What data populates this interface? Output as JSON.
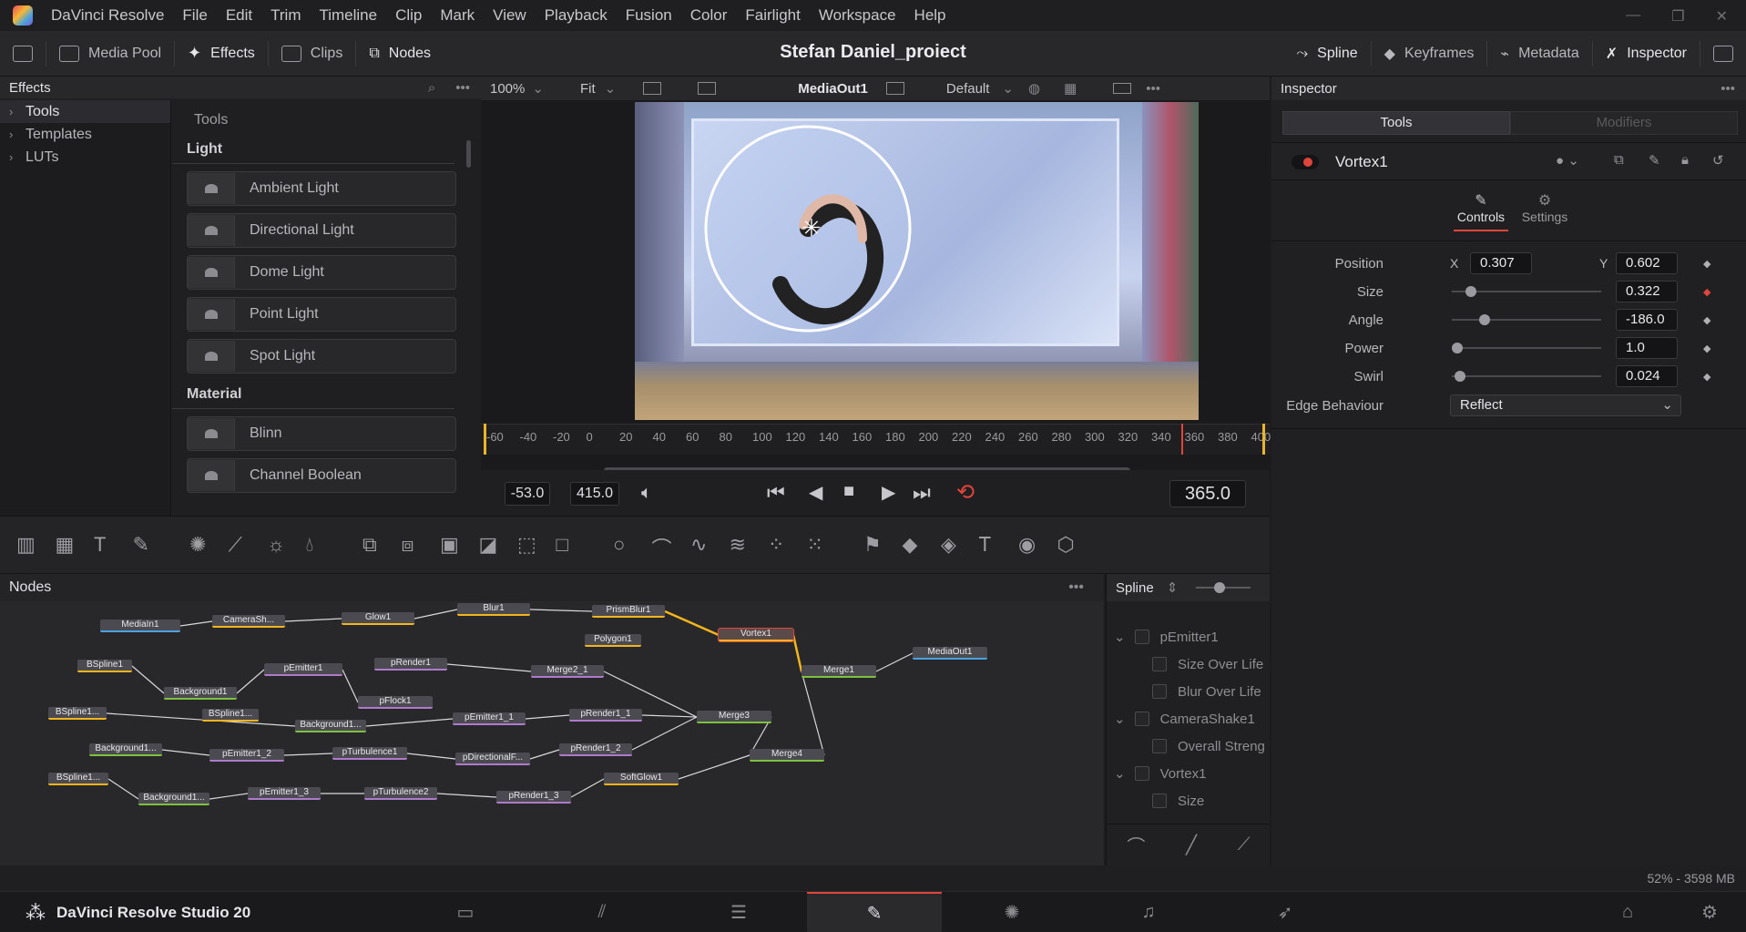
{
  "menubar": {
    "app": "DaVinci Resolve",
    "items": [
      "File",
      "Edit",
      "Trim",
      "Timeline",
      "Clip",
      "Mark",
      "View",
      "Playback",
      "Fusion",
      "Color",
      "Fairlight",
      "Workspace",
      "Help"
    ]
  },
  "toolbar": {
    "media_pool": "Media Pool",
    "effects": "Effects",
    "clips": "Clips",
    "nodes": "Nodes",
    "project_title": "Stefan Daniel_proiect",
    "spline": "Spline",
    "keyframes": "Keyframes",
    "metadata": "Metadata",
    "inspector": "Inspector"
  },
  "effects": {
    "title": "Effects",
    "tree": [
      "Tools",
      "Templates",
      "LUTs"
    ],
    "list_title": "Tools",
    "sections": [
      {
        "name": "Light",
        "items": [
          "Ambient Light",
          "Directional Light",
          "Dome Light",
          "Point Light",
          "Spot Light"
        ]
      },
      {
        "name": "Material",
        "items": [
          "Blinn",
          "Channel Boolean"
        ]
      }
    ]
  },
  "viewer": {
    "zoom": "100%",
    "fit": "Fit",
    "output": "MediaOut1",
    "lut": "Default",
    "ruler": [
      "-60",
      "-40",
      "-20",
      "0",
      "20",
      "40",
      "60",
      "80",
      "100",
      "120",
      "140",
      "160",
      "180",
      "200",
      "220",
      "240",
      "260",
      "280",
      "300",
      "320",
      "340",
      "360",
      "380",
      "400"
    ],
    "in": "-53.0",
    "out": "415.0",
    "current": "365.0"
  },
  "inspector": {
    "title": "Inspector",
    "tabs": [
      "Tools",
      "Modifiers"
    ],
    "tool_name": "Vortex1",
    "subtabs": [
      "Controls",
      "Settings"
    ],
    "position_label": "Position",
    "x_label": "X",
    "x": "0.307",
    "y_label": "Y",
    "y": "0.602",
    "params": [
      {
        "label": "Size",
        "value": "0.322",
        "level": 0.1
      },
      {
        "label": "Angle",
        "value": "-186.0",
        "level": 0.2
      },
      {
        "label": "Power",
        "value": "1.0",
        "level": 0
      },
      {
        "label": "Swirl",
        "value": "0.024",
        "level": 0.02
      }
    ],
    "edge_label": "Edge Behaviour",
    "edge_value": "Reflect"
  },
  "nodes": {
    "title": "Nodes",
    "list": [
      "MediaIn1",
      "CameraSh...",
      "Glow1",
      "Blur1",
      "PrismBlur1",
      "Polygon1",
      "Vortex1",
      "MediaOut1",
      "BSpline1",
      "pEmitter1",
      "pRender1",
      "Merge2_1",
      "Merge1",
      "Background1",
      "pFlock1",
      "BSpline1...",
      "BSpline1...",
      "Background1...",
      "pEmitter1_1",
      "pRender1_1",
      "Merge3",
      "Background1...",
      "pEmitter1_2",
      "pTurbulence1",
      "pDirectionalF...",
      "pRender1_2",
      "Merge4",
      "BSpline1...",
      "Background1...",
      "pEmitter1_3",
      "pTurbulence2",
      "pRender1_3",
      "SoftGlow1"
    ]
  },
  "spline": {
    "title": "Spline",
    "items": [
      {
        "label": "pEmitter1",
        "indent": 0
      },
      {
        "label": "Size Over Life",
        "indent": 1
      },
      {
        "label": "Blur Over Life",
        "indent": 1
      },
      {
        "label": "CameraShake1",
        "indent": 0
      },
      {
        "label": "Overall Streng",
        "indent": 1
      },
      {
        "label": "Vortex1",
        "indent": 0
      },
      {
        "label": "Size",
        "indent": 1
      }
    ]
  },
  "status": {
    "memory": "52% - 3598 MB"
  },
  "pagebar": {
    "brand": "DaVinci Resolve Studio 20"
  }
}
